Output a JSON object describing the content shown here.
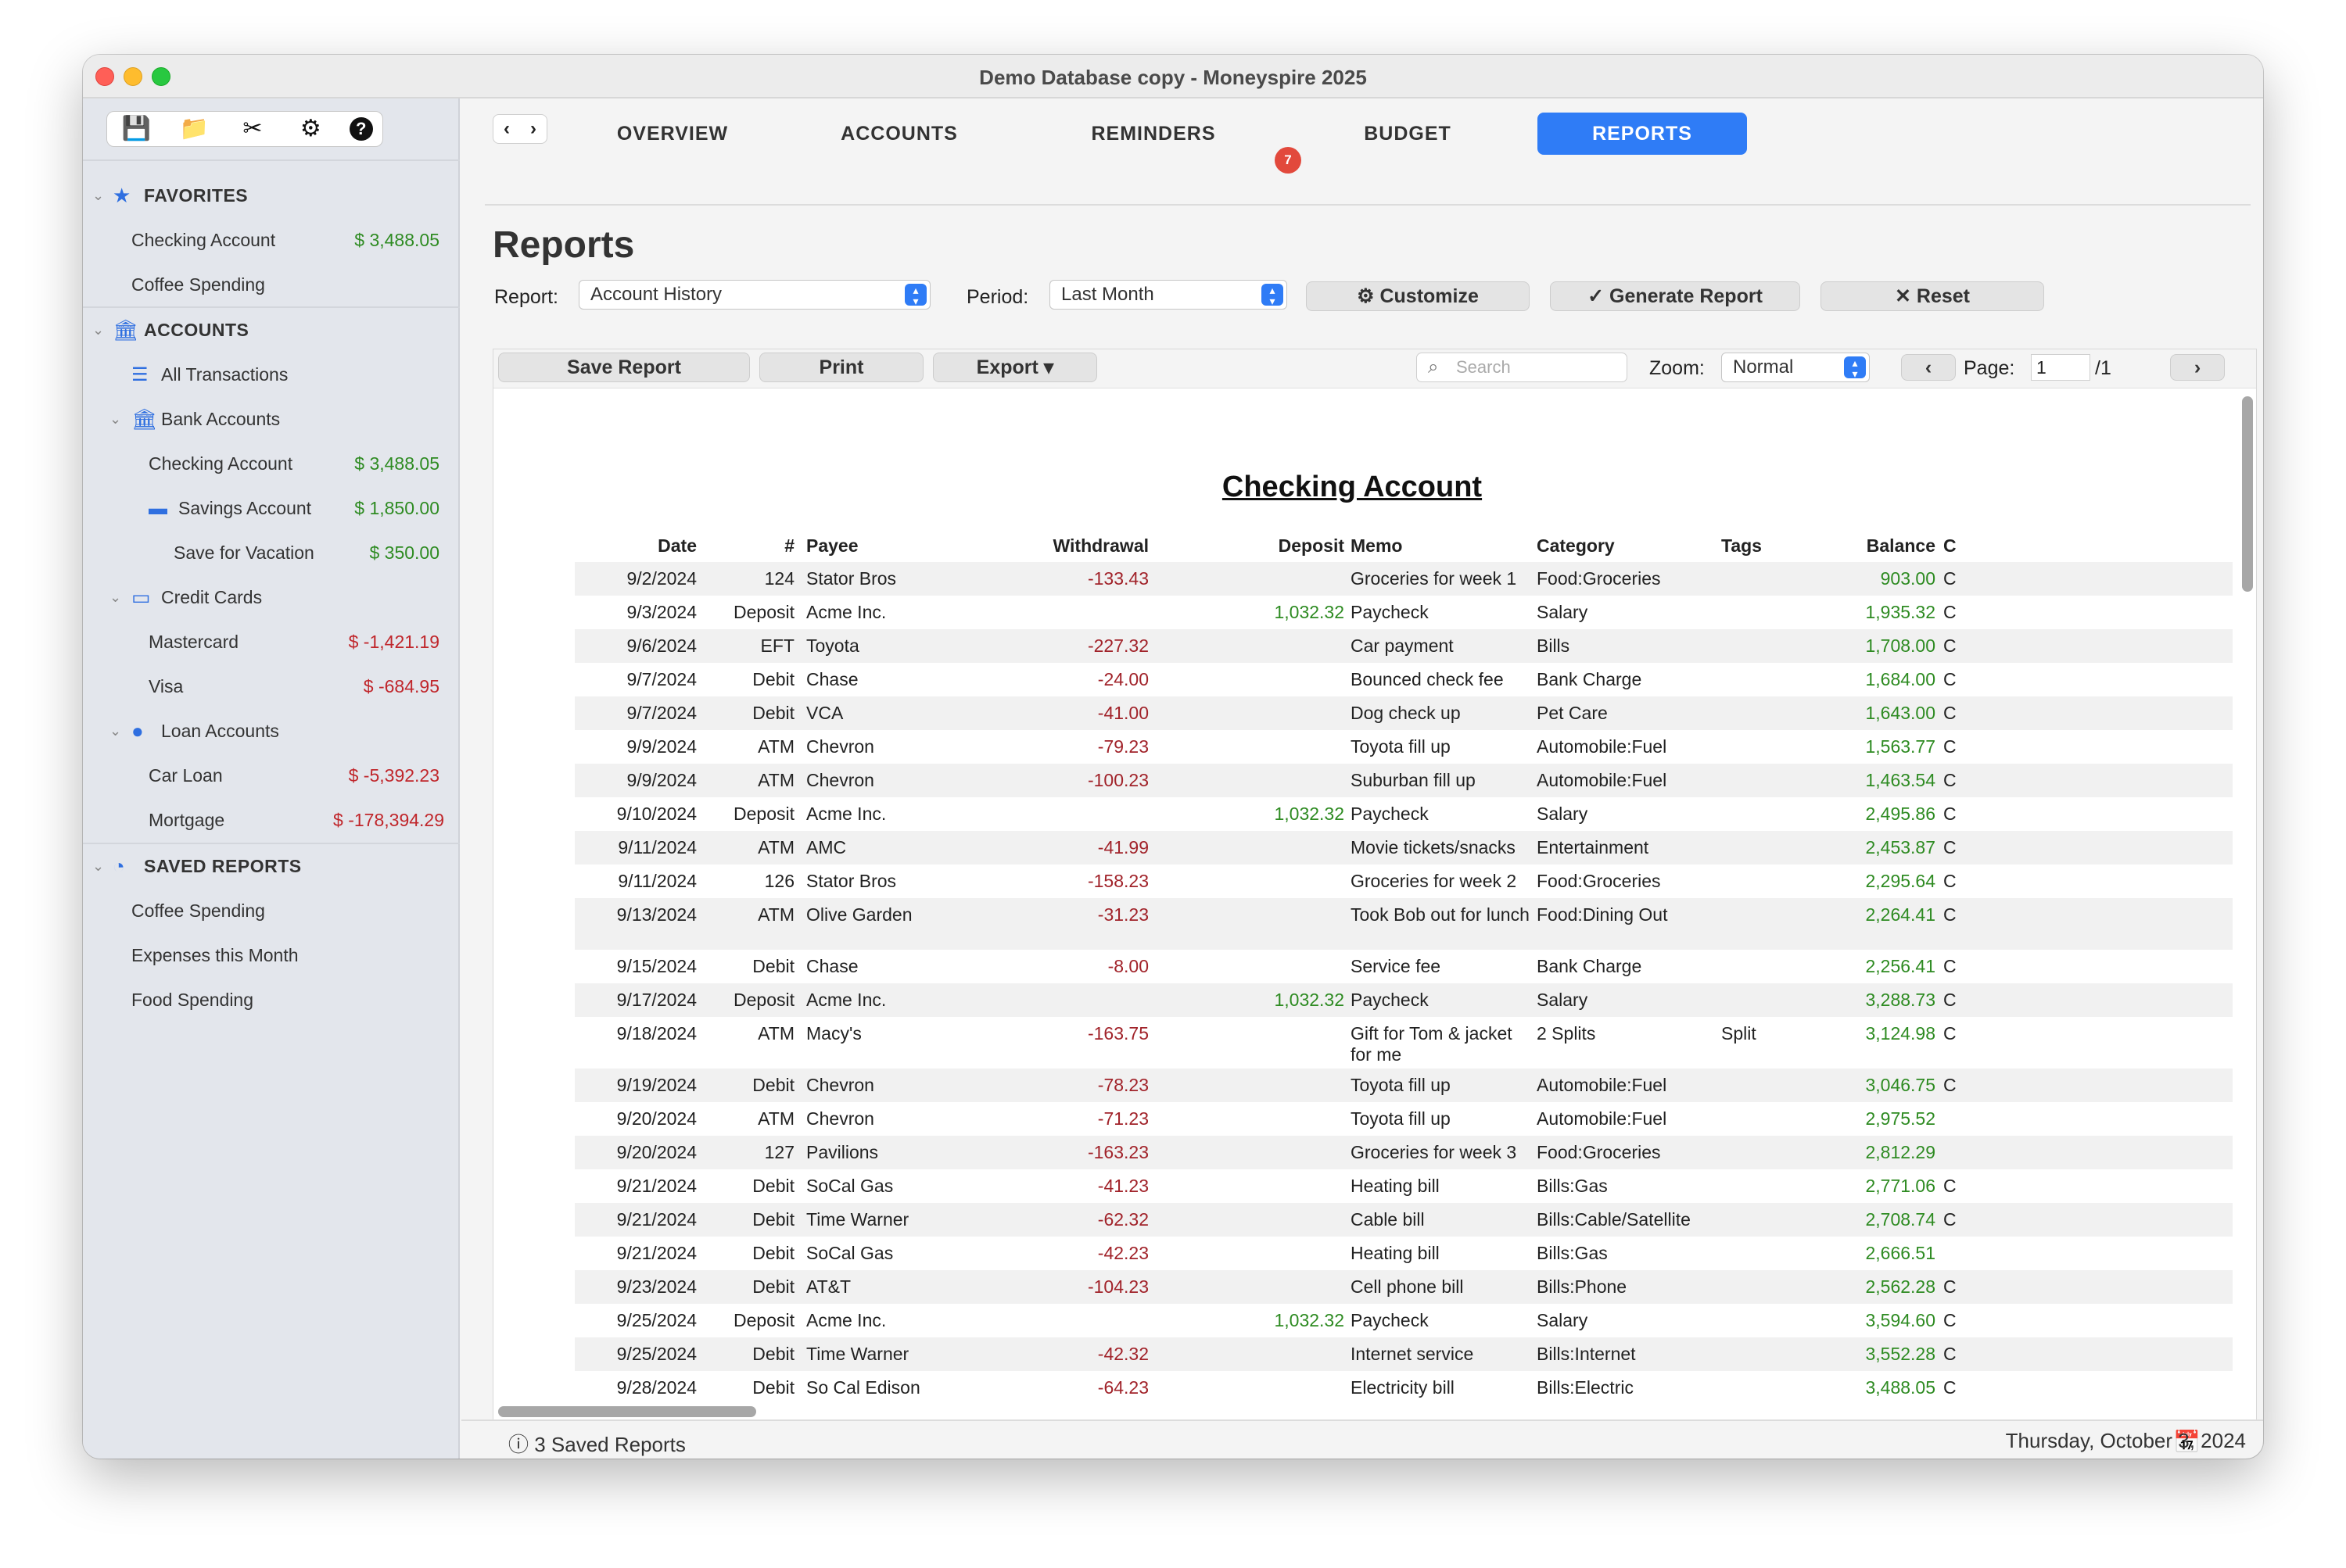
{
  "window": {
    "title": "Demo Database copy - Moneyspire 2025"
  },
  "sidebar": {
    "toolbar": [
      {
        "name": "save-icon",
        "glyph": "💾"
      },
      {
        "name": "folder-icon",
        "glyph": "📁"
      },
      {
        "name": "tools-icon",
        "glyph": "✂"
      },
      {
        "name": "gear-icon",
        "glyph": "⚙"
      },
      {
        "name": "help-icon",
        "glyph": "?"
      }
    ],
    "favorites": {
      "title": "FAVORITES",
      "items": [
        {
          "label": "Checking Account",
          "amount": "$ 3,488.05"
        },
        {
          "label": "Coffee Spending",
          "amount": ""
        }
      ]
    },
    "accounts": {
      "title": "ACCOUNTS",
      "all_transactions": "All Transactions",
      "bank": {
        "label": "Bank Accounts",
        "items": [
          {
            "label": "Checking Account",
            "amount": "$ 3,488.05"
          },
          {
            "label": "Savings Account",
            "amount": "$ 1,850.00"
          },
          {
            "label": "Save for Vacation",
            "amount": "$ 350.00"
          }
        ]
      },
      "credit": {
        "label": "Credit Cards",
        "items": [
          {
            "label": "Mastercard",
            "amount": "$ -1,421.19"
          },
          {
            "label": "Visa",
            "amount": "$ -684.95"
          }
        ]
      },
      "loan": {
        "label": "Loan Accounts",
        "items": [
          {
            "label": "Car Loan",
            "amount": "$ -5,392.23"
          },
          {
            "label": "Mortgage",
            "amount": "$ -178,394.29"
          }
        ]
      }
    },
    "saved_reports": {
      "title": "SAVED REPORTS",
      "items": [
        "Coffee Spending",
        "Expenses this Month",
        "Food Spending"
      ]
    }
  },
  "nav": {
    "tabs": [
      "OVERVIEW",
      "ACCOUNTS",
      "REMINDERS",
      "BUDGET",
      "REPORTS"
    ],
    "active": "REPORTS",
    "reminders_badge": "7"
  },
  "page": {
    "title": "Reports",
    "report_label": "Report:",
    "report_value": "Account History",
    "period_label": "Period:",
    "period_value": "Last Month",
    "customize": "⚙ Customize",
    "generate": "✓ Generate Report",
    "reset": "✕ Reset"
  },
  "toolbar": {
    "save_report": "Save Report",
    "print": "Print",
    "export": "Export ▾",
    "search_placeholder": "Search",
    "zoom_label": "Zoom:",
    "zoom_value": "Normal",
    "page_label": "Page:",
    "page_value": "1",
    "page_total": "/1"
  },
  "report": {
    "title": "Checking Account",
    "columns": [
      "Date",
      "#",
      "Payee",
      "Withdrawal",
      "Deposit",
      "Memo",
      "Category",
      "Tags",
      "Balance",
      "C"
    ],
    "rows": [
      {
        "date": "9/2/2024",
        "num": "124",
        "payee": "Stator Bros",
        "withdrawal": "-133.43",
        "deposit": "",
        "memo": "Groceries for week 1",
        "category": "Food:Groceries",
        "tags": "",
        "balance": "903.00",
        "c": "C"
      },
      {
        "date": "9/3/2024",
        "num": "Deposit",
        "payee": "Acme Inc.",
        "withdrawal": "",
        "deposit": "1,032.32",
        "memo": "Paycheck",
        "category": "Salary",
        "tags": "",
        "balance": "1,935.32",
        "c": "C"
      },
      {
        "date": "9/6/2024",
        "num": "EFT",
        "payee": "Toyota",
        "withdrawal": "-227.32",
        "deposit": "",
        "memo": "Car payment",
        "category": "Bills",
        "tags": "",
        "balance": "1,708.00",
        "c": "C"
      },
      {
        "date": "9/7/2024",
        "num": "Debit",
        "payee": "Chase",
        "withdrawal": "-24.00",
        "deposit": "",
        "memo": "Bounced check fee",
        "category": "Bank Charge",
        "tags": "",
        "balance": "1,684.00",
        "c": "C"
      },
      {
        "date": "9/7/2024",
        "num": "Debit",
        "payee": "VCA",
        "withdrawal": "-41.00",
        "deposit": "",
        "memo": "Dog check up",
        "category": "Pet Care",
        "tags": "",
        "balance": "1,643.00",
        "c": "C"
      },
      {
        "date": "9/9/2024",
        "num": "ATM",
        "payee": "Chevron",
        "withdrawal": "-79.23",
        "deposit": "",
        "memo": "Toyota fill up",
        "category": "Automobile:Fuel",
        "tags": "",
        "balance": "1,563.77",
        "c": "C"
      },
      {
        "date": "9/9/2024",
        "num": "ATM",
        "payee": "Chevron",
        "withdrawal": "-100.23",
        "deposit": "",
        "memo": "Suburban fill up",
        "category": "Automobile:Fuel",
        "tags": "",
        "balance": "1,463.54",
        "c": "C"
      },
      {
        "date": "9/10/2024",
        "num": "Deposit",
        "payee": "Acme Inc.",
        "withdrawal": "",
        "deposit": "1,032.32",
        "memo": "Paycheck",
        "category": "Salary",
        "tags": "",
        "balance": "2,495.86",
        "c": "C"
      },
      {
        "date": "9/11/2024",
        "num": "ATM",
        "payee": "AMC",
        "withdrawal": "-41.99",
        "deposit": "",
        "memo": "Movie tickets/snacks",
        "category": "Entertainment",
        "tags": "",
        "balance": "2,453.87",
        "c": "C"
      },
      {
        "date": "9/11/2024",
        "num": "126",
        "payee": "Stator Bros",
        "withdrawal": "-158.23",
        "deposit": "",
        "memo": "Groceries for week 2",
        "category": "Food:Groceries",
        "tags": "",
        "balance": "2,295.64",
        "c": "C"
      },
      {
        "date": "9/13/2024",
        "num": "ATM",
        "payee": "Olive Garden",
        "withdrawal": "-31.23",
        "deposit": "",
        "memo": "Took Bob out for lunch",
        "category": "Food:Dining Out",
        "tags": "",
        "balance": "2,264.41",
        "c": "C"
      },
      {
        "date": "9/15/2024",
        "num": "Debit",
        "payee": "Chase",
        "withdrawal": "-8.00",
        "deposit": "",
        "memo": "Service fee",
        "category": "Bank Charge",
        "tags": "",
        "balance": "2,256.41",
        "c": "C"
      },
      {
        "date": "9/17/2024",
        "num": "Deposit",
        "payee": "Acme Inc.",
        "withdrawal": "",
        "deposit": "1,032.32",
        "memo": "Paycheck",
        "category": "Salary",
        "tags": "",
        "balance": "3,288.73",
        "c": "C"
      },
      {
        "date": "9/18/2024",
        "num": "ATM",
        "payee": "Macy's",
        "withdrawal": "-163.75",
        "deposit": "",
        "memo": "Gift for Tom & jacket for me",
        "category": "2 Splits",
        "tags": "Split",
        "balance": "3,124.98",
        "c": "C"
      },
      {
        "date": "9/19/2024",
        "num": "Debit",
        "payee": "Chevron",
        "withdrawal": "-78.23",
        "deposit": "",
        "memo": "Toyota fill up",
        "category": "Automobile:Fuel",
        "tags": "",
        "balance": "3,046.75",
        "c": "C"
      },
      {
        "date": "9/20/2024",
        "num": "ATM",
        "payee": "Chevron",
        "withdrawal": "-71.23",
        "deposit": "",
        "memo": "Toyota fill up",
        "category": "Automobile:Fuel",
        "tags": "",
        "balance": "2,975.52",
        "c": ""
      },
      {
        "date": "9/20/2024",
        "num": "127",
        "payee": "Pavilions",
        "withdrawal": "-163.23",
        "deposit": "",
        "memo": "Groceries for week 3",
        "category": "Food:Groceries",
        "tags": "",
        "balance": "2,812.29",
        "c": ""
      },
      {
        "date": "9/21/2024",
        "num": "Debit",
        "payee": "SoCal Gas",
        "withdrawal": "-41.23",
        "deposit": "",
        "memo": "Heating bill",
        "category": "Bills:Gas",
        "tags": "",
        "balance": "2,771.06",
        "c": "C"
      },
      {
        "date": "9/21/2024",
        "num": "Debit",
        "payee": "Time Warner",
        "withdrawal": "-62.32",
        "deposit": "",
        "memo": "Cable bill",
        "category": "Bills:Cable/Satellite",
        "tags": "",
        "balance": "2,708.74",
        "c": "C"
      },
      {
        "date": "9/21/2024",
        "num": "Debit",
        "payee": "SoCal Gas",
        "withdrawal": "-42.23",
        "deposit": "",
        "memo": "Heating bill",
        "category": "Bills:Gas",
        "tags": "",
        "balance": "2,666.51",
        "c": ""
      },
      {
        "date": "9/23/2024",
        "num": "Debit",
        "payee": "AT&T",
        "withdrawal": "-104.23",
        "deposit": "",
        "memo": "Cell phone bill",
        "category": "Bills:Phone",
        "tags": "",
        "balance": "2,562.28",
        "c": "C"
      },
      {
        "date": "9/25/2024",
        "num": "Deposit",
        "payee": "Acme Inc.",
        "withdrawal": "",
        "deposit": "1,032.32",
        "memo": "Paycheck",
        "category": "Salary",
        "tags": "",
        "balance": "3,594.60",
        "c": "C"
      },
      {
        "date": "9/25/2024",
        "num": "Debit",
        "payee": "Time Warner",
        "withdrawal": "-42.32",
        "deposit": "",
        "memo": "Internet service",
        "category": "Bills:Internet",
        "tags": "",
        "balance": "3,552.28",
        "c": "C"
      },
      {
        "date": "9/28/2024",
        "num": "Debit",
        "payee": "So Cal Edison",
        "withdrawal": "-64.23",
        "deposit": "",
        "memo": "Electricity bill",
        "category": "Bills:Electric",
        "tags": "",
        "balance": "3,488.05",
        "c": "C"
      }
    ]
  },
  "status": {
    "saved_reports": "ⓘ 3 Saved Reports",
    "date": "Thursday, October 3, 2024"
  },
  "colors": {
    "accent": "#2f7cf6",
    "positive": "#2e8b22",
    "negative": "#c0262b",
    "badge": "#e2493c"
  }
}
